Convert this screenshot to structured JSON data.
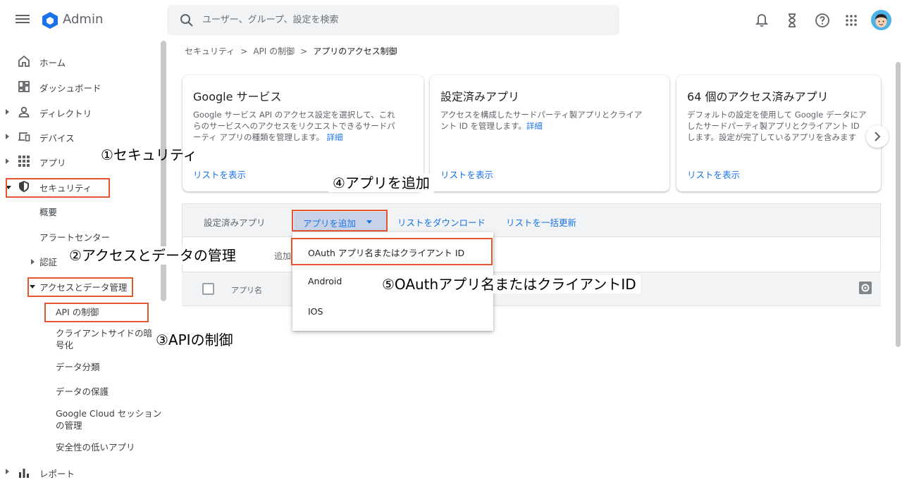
{
  "app": {
    "title": "Admin"
  },
  "search": {
    "placeholder": "ユーザー、グループ、設定を検索"
  },
  "sidebar": {
    "items": [
      {
        "label": "ホーム",
        "icon": "home-icon"
      },
      {
        "label": "ダッシュボード",
        "icon": "dashboard-icon"
      },
      {
        "label": "ディレクトリ",
        "icon": "person-icon"
      },
      {
        "label": "デバイス",
        "icon": "devices-icon"
      },
      {
        "label": "アプリ",
        "icon": "apps-grid-icon"
      },
      {
        "label": "セキュリティ",
        "icon": "shield-icon"
      }
    ],
    "security_sub": {
      "overview": "概要",
      "alert_center": "アラートセンター",
      "auth": "認証",
      "access_data": "アクセスとデータ管理",
      "api_control": "API の制御",
      "client_encryption_1": "クライアントサイドの暗",
      "client_encryption_2": "号化",
      "data_class": "データ分類",
      "data_protect": "データの保護",
      "gcloud_session_1": "Google Cloud セッション",
      "gcloud_session_2": "の管理",
      "less_secure": "安全性の低いアプリ",
      "reports": "レポート"
    }
  },
  "breadcrumb": {
    "items": [
      "セキュリティ",
      "API の制御",
      "アプリのアクセス制御"
    ],
    "separator": ">"
  },
  "cards": [
    {
      "title": "Google サービス",
      "desc_1": "Google サービス API のアクセス設定を選択して、これ",
      "desc_2": "らのサービスへのアクセスをリクエストできるサードパ",
      "desc_3": "ーティ アプリの種類を管理します。",
      "link": "詳細",
      "show": "リストを表示"
    },
    {
      "title": "設定済みアプリ",
      "desc_1": "アクセスを構成したサードパーティ製アプリとクライア",
      "desc_2": "ント ID を管理します。",
      "link": "詳細",
      "show": "リストを表示"
    },
    {
      "title": "64 個のアクセス済みアプリ",
      "desc_1": "デフォルトの設定を使用して Google データにア",
      "desc_2": "したサードパーティ製アプリとクライアント ID",
      "desc_3": "します。設定が完了しているアプリを含みます",
      "show": "リストを表示"
    }
  ],
  "panel": {
    "title": "設定済みアプリ",
    "add_app": "アプリを追加",
    "download": "リストをダウンロード",
    "bulk_update": "リストを一括更新",
    "filter_placeholder": "追加",
    "col_app_name": "アプリ名"
  },
  "dropdown": {
    "items": [
      "OAuth アプリ名またはクライアント ID",
      "Android",
      "IOS"
    ]
  },
  "annotations": {
    "a1": "①セキュリティ",
    "a2": "②アクセスとデータの管理",
    "a3": "③APIの制御",
    "a4": "④アプリを追加",
    "a5": "⑤OAuthアプリ名またはクライアントID"
  },
  "colors": {
    "accent": "#1a73e8",
    "highlight": "#e4572e"
  }
}
